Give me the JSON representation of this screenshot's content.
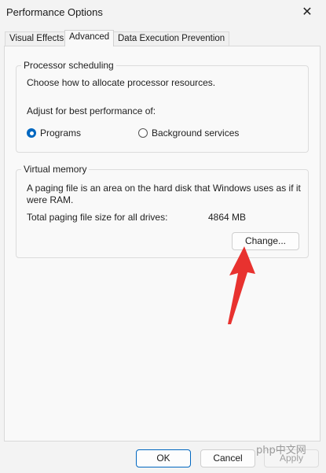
{
  "window": {
    "title": "Performance Options",
    "close_glyph": "✕"
  },
  "tabs": [
    {
      "label": "Visual Effects"
    },
    {
      "label": "Advanced"
    },
    {
      "label": "Data Execution Prevention"
    }
  ],
  "processor": {
    "legend": "Processor scheduling",
    "description": "Choose how to allocate processor resources.",
    "adjust_label": "Adjust for best performance of:",
    "options": [
      {
        "label": "Programs",
        "selected": true
      },
      {
        "label": "Background services",
        "selected": false
      }
    ]
  },
  "virtual_memory": {
    "legend": "Virtual memory",
    "desc_line1": "A paging file is an area on the hard disk that Windows uses as if it",
    "desc_line2": "were RAM.",
    "total_label": "Total paging file size for all drives:",
    "total_value": "4864 MB",
    "change_label": "Change..."
  },
  "footer": {
    "ok_label": "OK",
    "cancel_label": "Cancel",
    "apply_label": "Apply"
  },
  "watermark": {
    "text": "php",
    "suffix": "中文网"
  },
  "colors": {
    "accent": "#0067c0",
    "annotation_arrow": "#e8322f"
  }
}
